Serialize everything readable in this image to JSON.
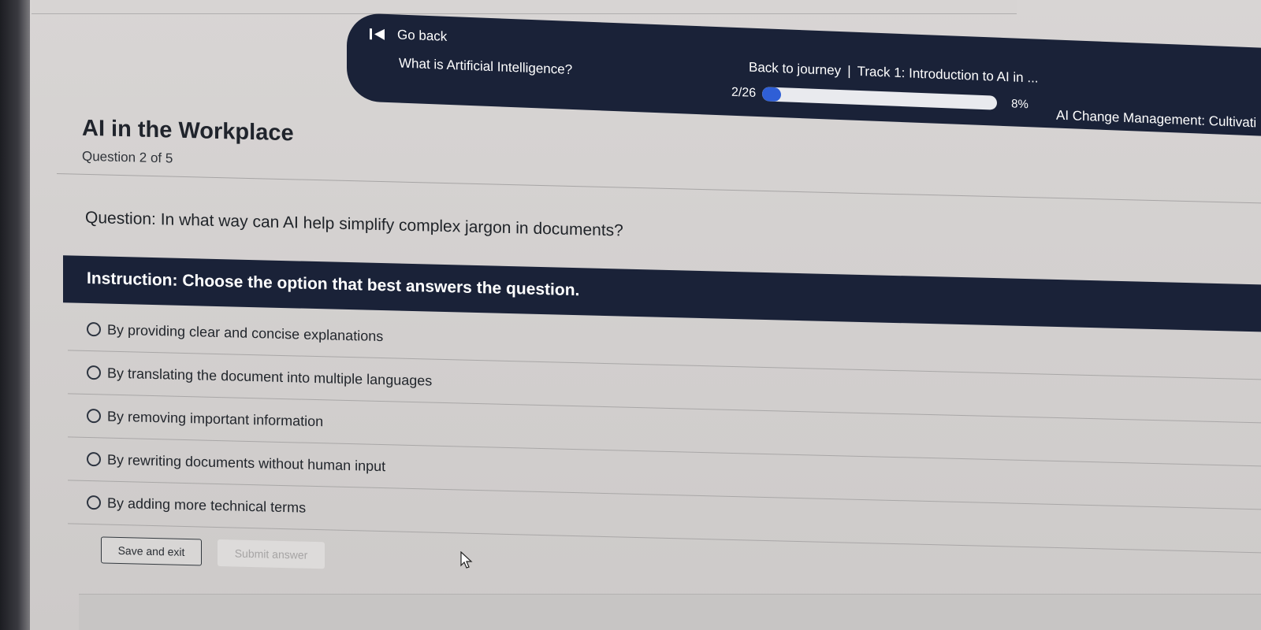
{
  "header": {
    "go_back_label": "Go back",
    "lesson_title": "What is Artificial Intelligence?",
    "journey_link": "Back to journey",
    "separator": "|",
    "track_title": "Track 1: Introduction to AI in ...",
    "progress_count": "2/26",
    "progress_percent_label": "8%",
    "progress_fraction": 0.08,
    "course_title": "AI Change Management: Cultivati"
  },
  "page": {
    "title": "AI in the Workplace",
    "question_count": "Question 2 of 5",
    "question": "Question: In what way can AI help simplify complex jargon in documents?",
    "instruction": "Instruction: Choose the option that best answers the question."
  },
  "options": [
    "By providing clear and concise explanations",
    "By translating the document into multiple languages",
    "By removing important information",
    "By rewriting documents without human input",
    "By adding more technical terms"
  ],
  "actions": {
    "save_label": "Save and exit",
    "submit_label": "Submit answer"
  },
  "colors": {
    "header_bg": "#1a2238",
    "progress_fill": "#2f5fd6"
  }
}
